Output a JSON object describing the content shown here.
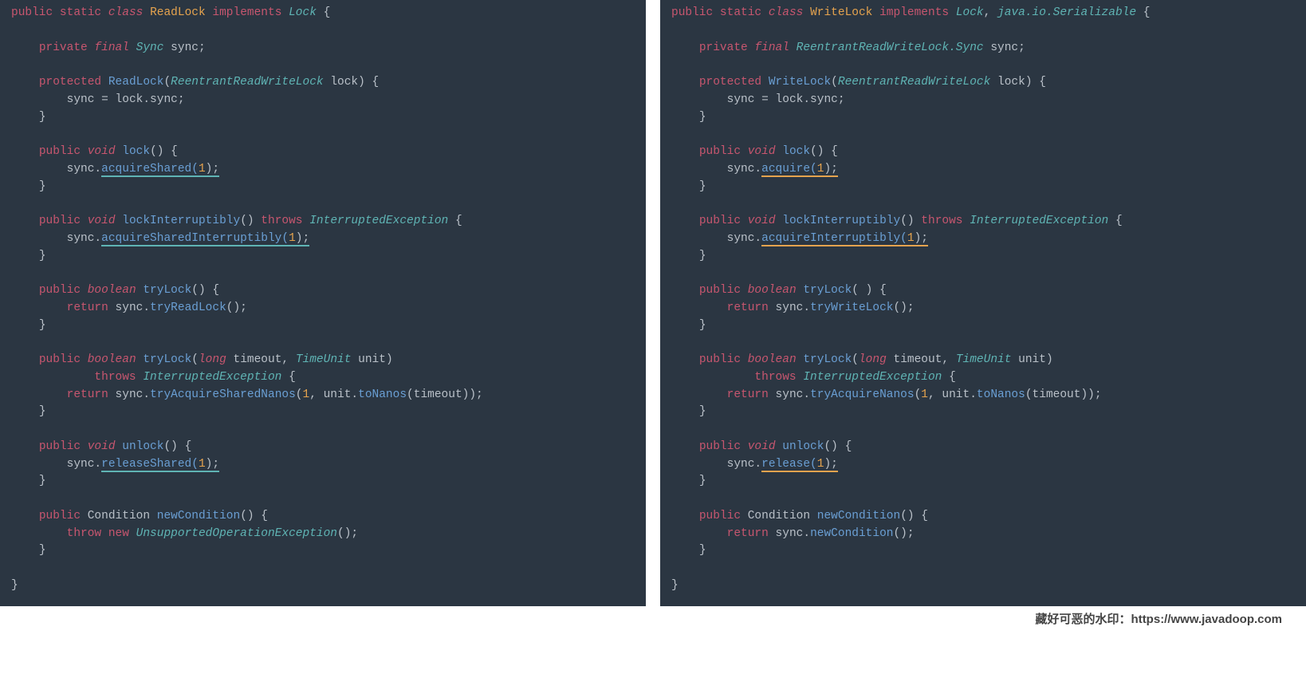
{
  "footer": {
    "text_cn": "藏好可恶的水印：",
    "url": "https://www.javadoop.com"
  },
  "left": {
    "l1": {
      "public": "public",
      "static": "static",
      "class": "class",
      "name": "ReadLock",
      "implements": "implements",
      "iface": "Lock",
      "ob": "{"
    },
    "l3": {
      "private": "private",
      "final": "final",
      "type": "Sync",
      "var": "sync;"
    },
    "l5": {
      "protected": "protected",
      "ctor": "ReadLock",
      "ptype": "ReentrantReadWriteLock",
      "pname": "lock",
      "tail": ") {"
    },
    "l6": "sync = lock.sync;",
    "l7": "}",
    "l9": {
      "public": "public",
      "void": "void",
      "name": "lock",
      "tail": "() {"
    },
    "l10": {
      "sync": "sync.",
      "call": "acquireShared(",
      "arg": "1",
      "end": ");"
    },
    "l11": "}",
    "l13": {
      "public": "public",
      "void": "void",
      "name": "lockInterruptibly",
      "mid": "()",
      "throws": "throws",
      "ex": "InterruptedException",
      "ob": "{"
    },
    "l14": {
      "sync": "sync.",
      "call": "acquireSharedInterruptibly(",
      "arg": "1",
      "end": ");"
    },
    "l15": "}",
    "l17": {
      "public": "public",
      "bool": "boolean",
      "name": "tryLock",
      "tail": "() {"
    },
    "l18": {
      "ret": "return",
      "sync": "sync.",
      "call": "tryReadLock",
      "end": "();"
    },
    "l19": "}",
    "l21": {
      "public": "public",
      "bool": "boolean",
      "name": "tryLock",
      "long": "long",
      "p1": "timeout,",
      "tu": "TimeUnit",
      "p2": "unit)"
    },
    "l22": {
      "throws": "throws",
      "ex": "InterruptedException",
      "ob": "{"
    },
    "l23": {
      "ret": "return",
      "sync": "sync.",
      "call": "tryAcquireSharedNanos",
      "open": "(",
      "arg1": "1",
      "mid": ", unit.",
      "call2": "toNanos",
      "end": "(timeout));"
    },
    "l24": "}",
    "l26": {
      "public": "public",
      "void": "void",
      "name": "unlock",
      "tail": "() {"
    },
    "l27": {
      "sync": "sync.",
      "call": "releaseShared(",
      "arg": "1",
      "end": ");"
    },
    "l28": "}",
    "l30": {
      "public": "public",
      "type": "Condition",
      "name": "newCondition",
      "tail": "() {"
    },
    "l31": {
      "throw": "throw",
      "new": "new",
      "ex": "UnsupportedOperationException",
      "end": "();"
    },
    "l32": "}",
    "l34": "}"
  },
  "right": {
    "l1": {
      "public": "public",
      "static": "static",
      "class": "class",
      "name": "WriteLock",
      "implements": "implements",
      "iface": "Lock",
      "comma": ",",
      "iface2": "java.io.Serializable",
      "ob": "{"
    },
    "l3": {
      "private": "private",
      "final": "final",
      "type": "ReentrantReadWriteLock.Sync",
      "var": "sync;"
    },
    "l5": {
      "protected": "protected",
      "ctor": "WriteLock",
      "ptype": "ReentrantReadWriteLock",
      "pname": "lock",
      "tail": ") {"
    },
    "l6": "sync = lock.sync;",
    "l7": "}",
    "l9": {
      "public": "public",
      "void": "void",
      "name": "lock",
      "tail": "() {"
    },
    "l10": {
      "sync": "sync.",
      "call": "acquire(",
      "arg": "1",
      "end": ");"
    },
    "l11": "}",
    "l13": {
      "public": "public",
      "void": "void",
      "name": "lockInterruptibly",
      "mid": "()",
      "throws": "throws",
      "ex": "InterruptedException",
      "ob": "{"
    },
    "l14": {
      "sync": "sync.",
      "call": "acquireInterruptibly(",
      "arg": "1",
      "end": ");"
    },
    "l15": "}",
    "l17": {
      "public": "public",
      "bool": "boolean",
      "name": "tryLock",
      "tail": "( ) {"
    },
    "l18": {
      "ret": "return",
      "sync": "sync.",
      "call": "tryWriteLock",
      "end": "();"
    },
    "l19": "}",
    "l21": {
      "public": "public",
      "bool": "boolean",
      "name": "tryLock",
      "long": "long",
      "p1": "timeout,",
      "tu": "TimeUnit",
      "p2": "unit)"
    },
    "l22": {
      "throws": "throws",
      "ex": "InterruptedException",
      "ob": "{"
    },
    "l23": {
      "ret": "return",
      "sync": "sync.",
      "call": "tryAcquireNanos",
      "open": "(",
      "arg1": "1",
      "mid": ", unit.",
      "call2": "toNanos",
      "end": "(timeout));"
    },
    "l24": "}",
    "l26": {
      "public": "public",
      "void": "void",
      "name": "unlock",
      "tail": "() {"
    },
    "l27": {
      "sync": "sync.",
      "call": "release(",
      "arg": "1",
      "end": ");"
    },
    "l28": "}",
    "l30": {
      "public": "public",
      "type": "Condition",
      "name": "newCondition",
      "tail": "() {"
    },
    "l31": {
      "ret": "return",
      "sync": "sync.",
      "call": "newCondition",
      "end": "();"
    },
    "l32": "}",
    "l34": "}"
  }
}
